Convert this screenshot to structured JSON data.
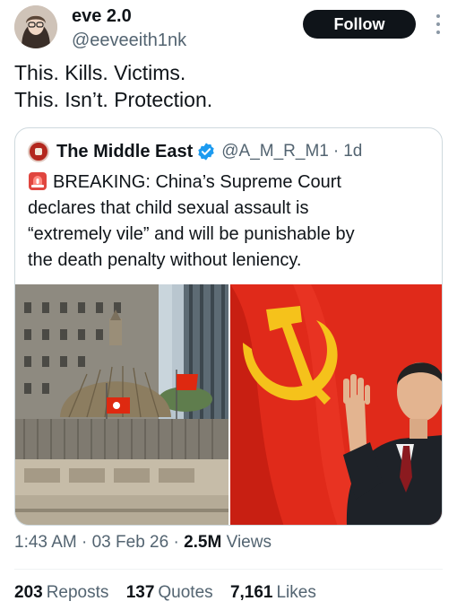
{
  "author": {
    "display_name": "eve 2.0",
    "handle": "@eeveeith1nk",
    "avatar_icon": "profile-photo",
    "follow_label": "Follow"
  },
  "tweet": {
    "lines": [
      "This. Kills. Victims.",
      "This. Isn’t. Protection."
    ]
  },
  "quote": {
    "name": "The Middle East",
    "handle": "@A_M_R_M1",
    "separator": "·",
    "time": "1d",
    "verified_color": "#1d9bf0",
    "text_lines": [
      "BREAKING: China’s Supreme Court",
      "declares that child sexual assault is",
      "“extremely vile” and will be punishable by",
      "the death penalty without leniency."
    ]
  },
  "meta": {
    "time": "1:43 AM",
    "sep1": "·",
    "date": "03 Feb 26",
    "sep2": "·",
    "views_count": "2.5M",
    "views_label": "Views"
  },
  "stats": {
    "reposts_count": "203",
    "reposts_label": "Reposts",
    "quotes_count": "137",
    "quotes_label": "Quotes",
    "likes_count": "7,161",
    "likes_label": "Likes"
  },
  "colors": {
    "text": "#0f1419",
    "secondary": "#536471",
    "border": "#cfd9de",
    "flag_red": "#de2910",
    "emblem_gold": "#f5c21b"
  }
}
